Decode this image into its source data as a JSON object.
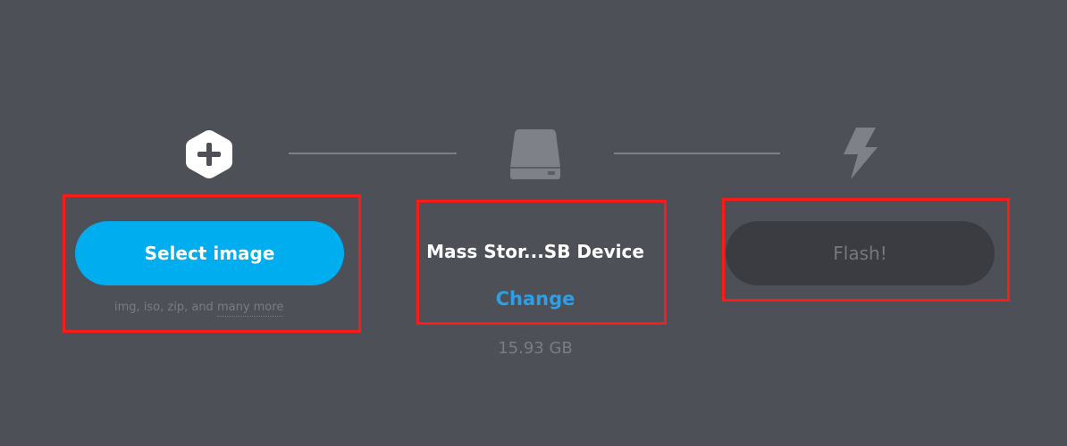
{
  "steps": {
    "image": {
      "icon": "plus-hexagon-icon",
      "button_label": "Select image",
      "footnote_prefix": "img, iso, zip, and",
      "footnote_link": "many more"
    },
    "drive": {
      "icon": "hard-drive-icon",
      "name": "Mass Stor...SB Device",
      "change_label": "Change",
      "size": "15.93 GB"
    },
    "flash": {
      "icon": "lightning-bolt-icon",
      "button_label": "Flash!"
    }
  },
  "colors": {
    "background": "#4d5057",
    "primary": "#00aeef",
    "link": "#2e9ee6",
    "disabled_button": "#3a3c41",
    "annotation": "#ff1a1a"
  }
}
